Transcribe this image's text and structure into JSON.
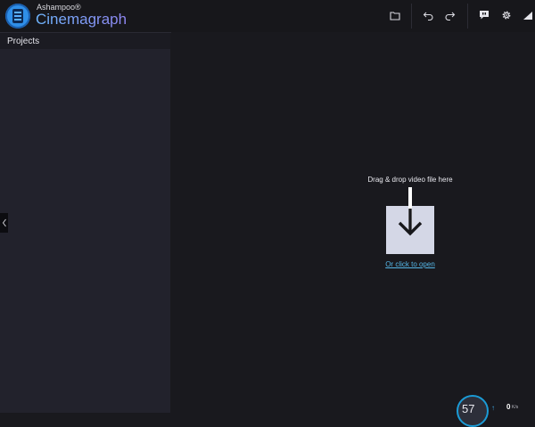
{
  "app": {
    "brand_small": "Ashampoo®",
    "brand_name": "Cinemagraph"
  },
  "toolbar": {
    "icons": [
      "folder-icon",
      "undo-icon",
      "redo-icon",
      "feedback-icon",
      "settings-icon",
      "chart-icon"
    ]
  },
  "sidebar": {
    "title": "Projects",
    "collapse_icon": "chevron-left-icon"
  },
  "dropzone": {
    "label": "Drag & drop video file here",
    "link": "Or click to open",
    "icon": "download-arrow-icon"
  },
  "status": {
    "performance_value": "57",
    "rate_value": "0",
    "rate_unit": "K/s"
  },
  "colors": {
    "background": "#19191e",
    "sidebar": "#22222c",
    "accent_link": "#55b7e8",
    "drop_box": "#d4d7e6",
    "brand_gradient_start": "#6fb6ff",
    "brand_gradient_end": "#8f86f2"
  }
}
